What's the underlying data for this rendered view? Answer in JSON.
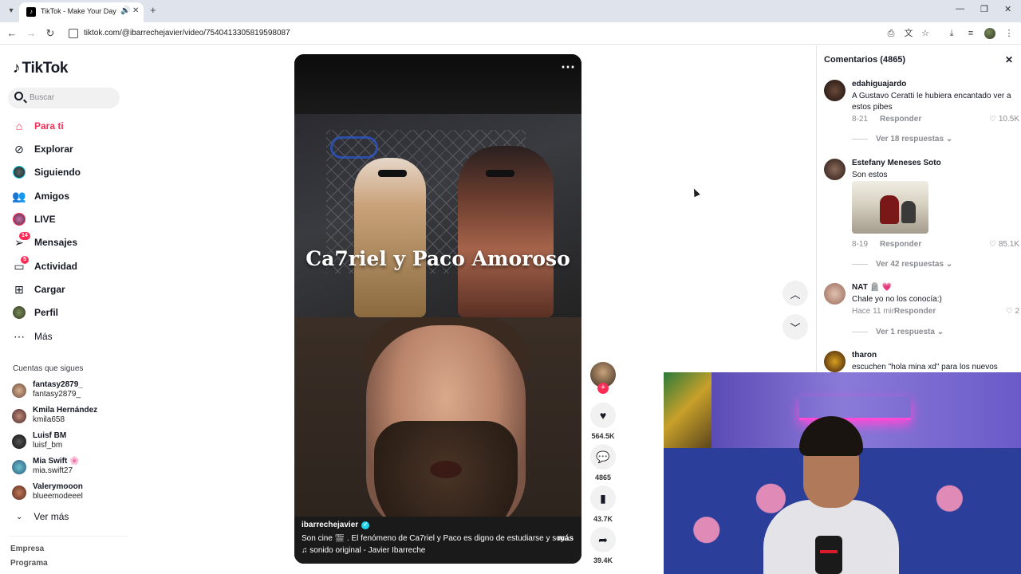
{
  "browser": {
    "tab_title": "TikTok - Make Your Day",
    "url": "tiktok.com/@ibarrechejavier/video/7540413305819598087"
  },
  "sidebar": {
    "logo": "TikTok",
    "search_placeholder": "Buscar",
    "nav": [
      {
        "label": "Para ti",
        "icon": "home-icon",
        "active": true
      },
      {
        "label": "Explorar",
        "icon": "compass-icon"
      },
      {
        "label": "Siguiendo",
        "icon": "following-icon"
      },
      {
        "label": "Amigos",
        "icon": "friends-icon"
      },
      {
        "label": "LIVE",
        "icon": "live-icon"
      },
      {
        "label": "Mensajes",
        "icon": "messages-icon",
        "badge": "14"
      },
      {
        "label": "Actividad",
        "icon": "activity-icon",
        "badge": "5"
      },
      {
        "label": "Cargar",
        "icon": "upload-icon"
      },
      {
        "label": "Perfil",
        "icon": "profile-icon"
      },
      {
        "label": "Más",
        "icon": "more-icon"
      }
    ],
    "following_title": "Cuentas que sigues",
    "following": [
      {
        "name": "fantasy2879_",
        "user": "fantasy2879_"
      },
      {
        "name": "Kmila Hernández",
        "user": "kmila658"
      },
      {
        "name": "Luisf BM",
        "user": "luisf_bm"
      },
      {
        "name": "Mia Swift 🌸",
        "user": "mia.swift27"
      },
      {
        "name": "Valerymooon",
        "user": "blueemodeeel"
      }
    ],
    "see_more": "Ver más",
    "footer": [
      "Empresa",
      "Programa"
    ]
  },
  "video": {
    "title_overlay": "Ca7riel y Paco Amoroso",
    "author": "ibarrechejavier",
    "description": "Son cine 🎬 . El fenómeno de Ca7riel y Paco es digno de estudiarse y soy...",
    "more": "más",
    "sound": "♫ sonido original - Javier Ibarreche"
  },
  "actions": {
    "likes": "564.5K",
    "comments": "4865",
    "saves": "43.7K",
    "shares": "39.4K"
  },
  "comments": {
    "header": "Comentarios (4865)",
    "items": [
      {
        "user": "edahiguajardo",
        "text": "A Gustavo Ceratti le hubiera encantado ver a estos pibes",
        "date": "8-21",
        "reply": "Responder",
        "likes": "10.5K",
        "replies": "Ver 18 respuestas"
      },
      {
        "user": "Estefany Meneses Soto",
        "text": "Son estos",
        "date": "8-19",
        "reply": "Responder",
        "likes": "85.1K",
        "replies": "Ver 42 respuestas"
      },
      {
        "user": "NAT 🪦 💗",
        "text": "Chale yo no los conocía:)",
        "date": "Hace 11 min",
        "reply": "Responder",
        "likes": "2",
        "replies": "Ver 1 respuesta"
      },
      {
        "user": "tharon",
        "text": "escuchen \"hola mina xd\" para los nuevos"
      }
    ]
  }
}
